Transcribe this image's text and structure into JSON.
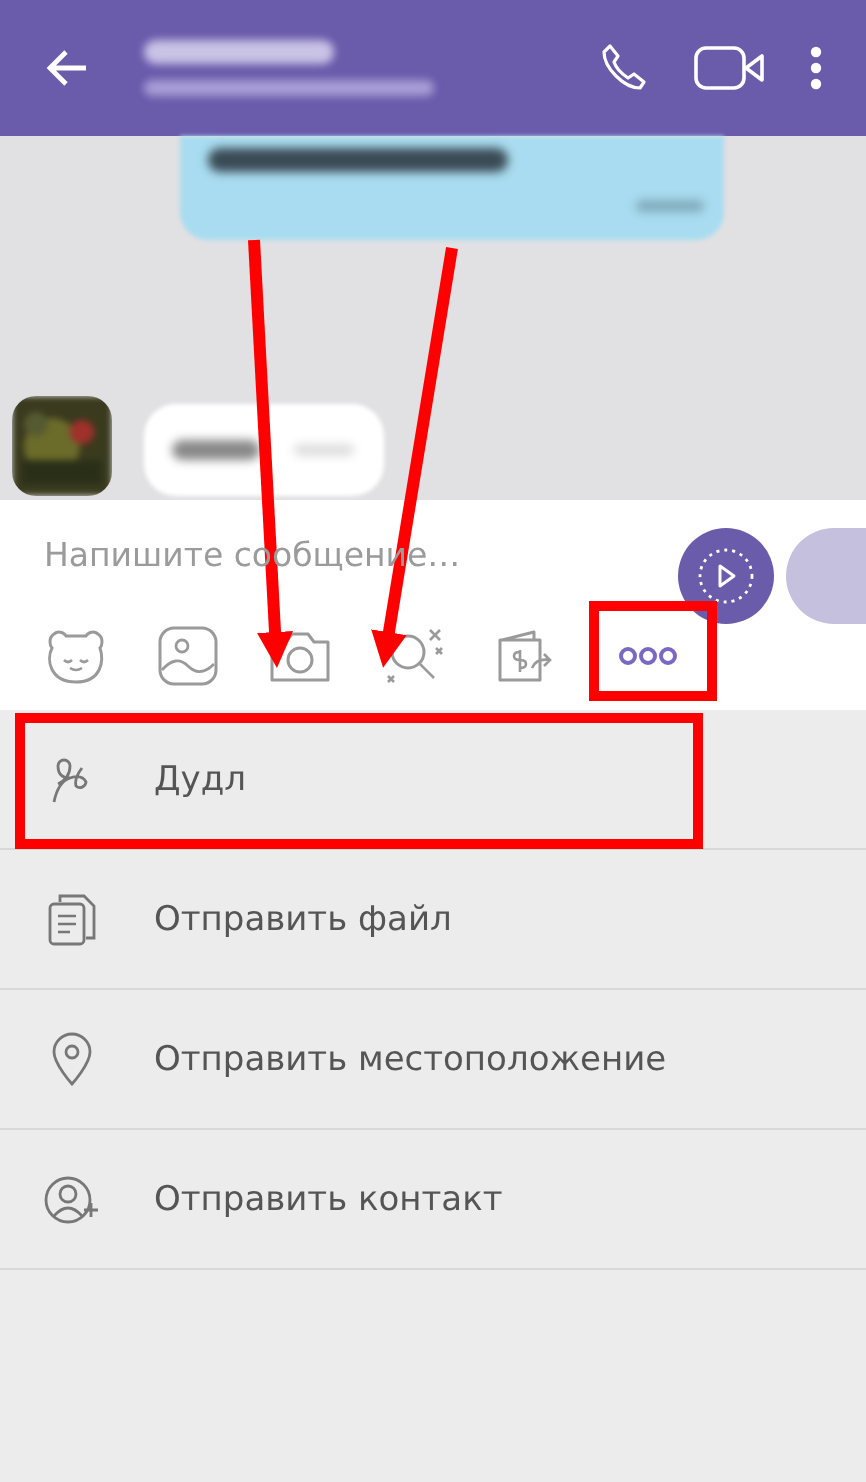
{
  "composer": {
    "placeholder": "Напишите сообщение…"
  },
  "toolbar": [
    {
      "kind": "sticker"
    },
    {
      "kind": "gallery"
    },
    {
      "kind": "camera"
    },
    {
      "kind": "gif"
    },
    {
      "kind": "money"
    },
    {
      "kind": "more"
    }
  ],
  "menu": [
    {
      "label": "Дудл"
    },
    {
      "label": "Отправить файл"
    },
    {
      "label": "Отправить местоположение"
    },
    {
      "label": "Отправить контакт"
    }
  ]
}
